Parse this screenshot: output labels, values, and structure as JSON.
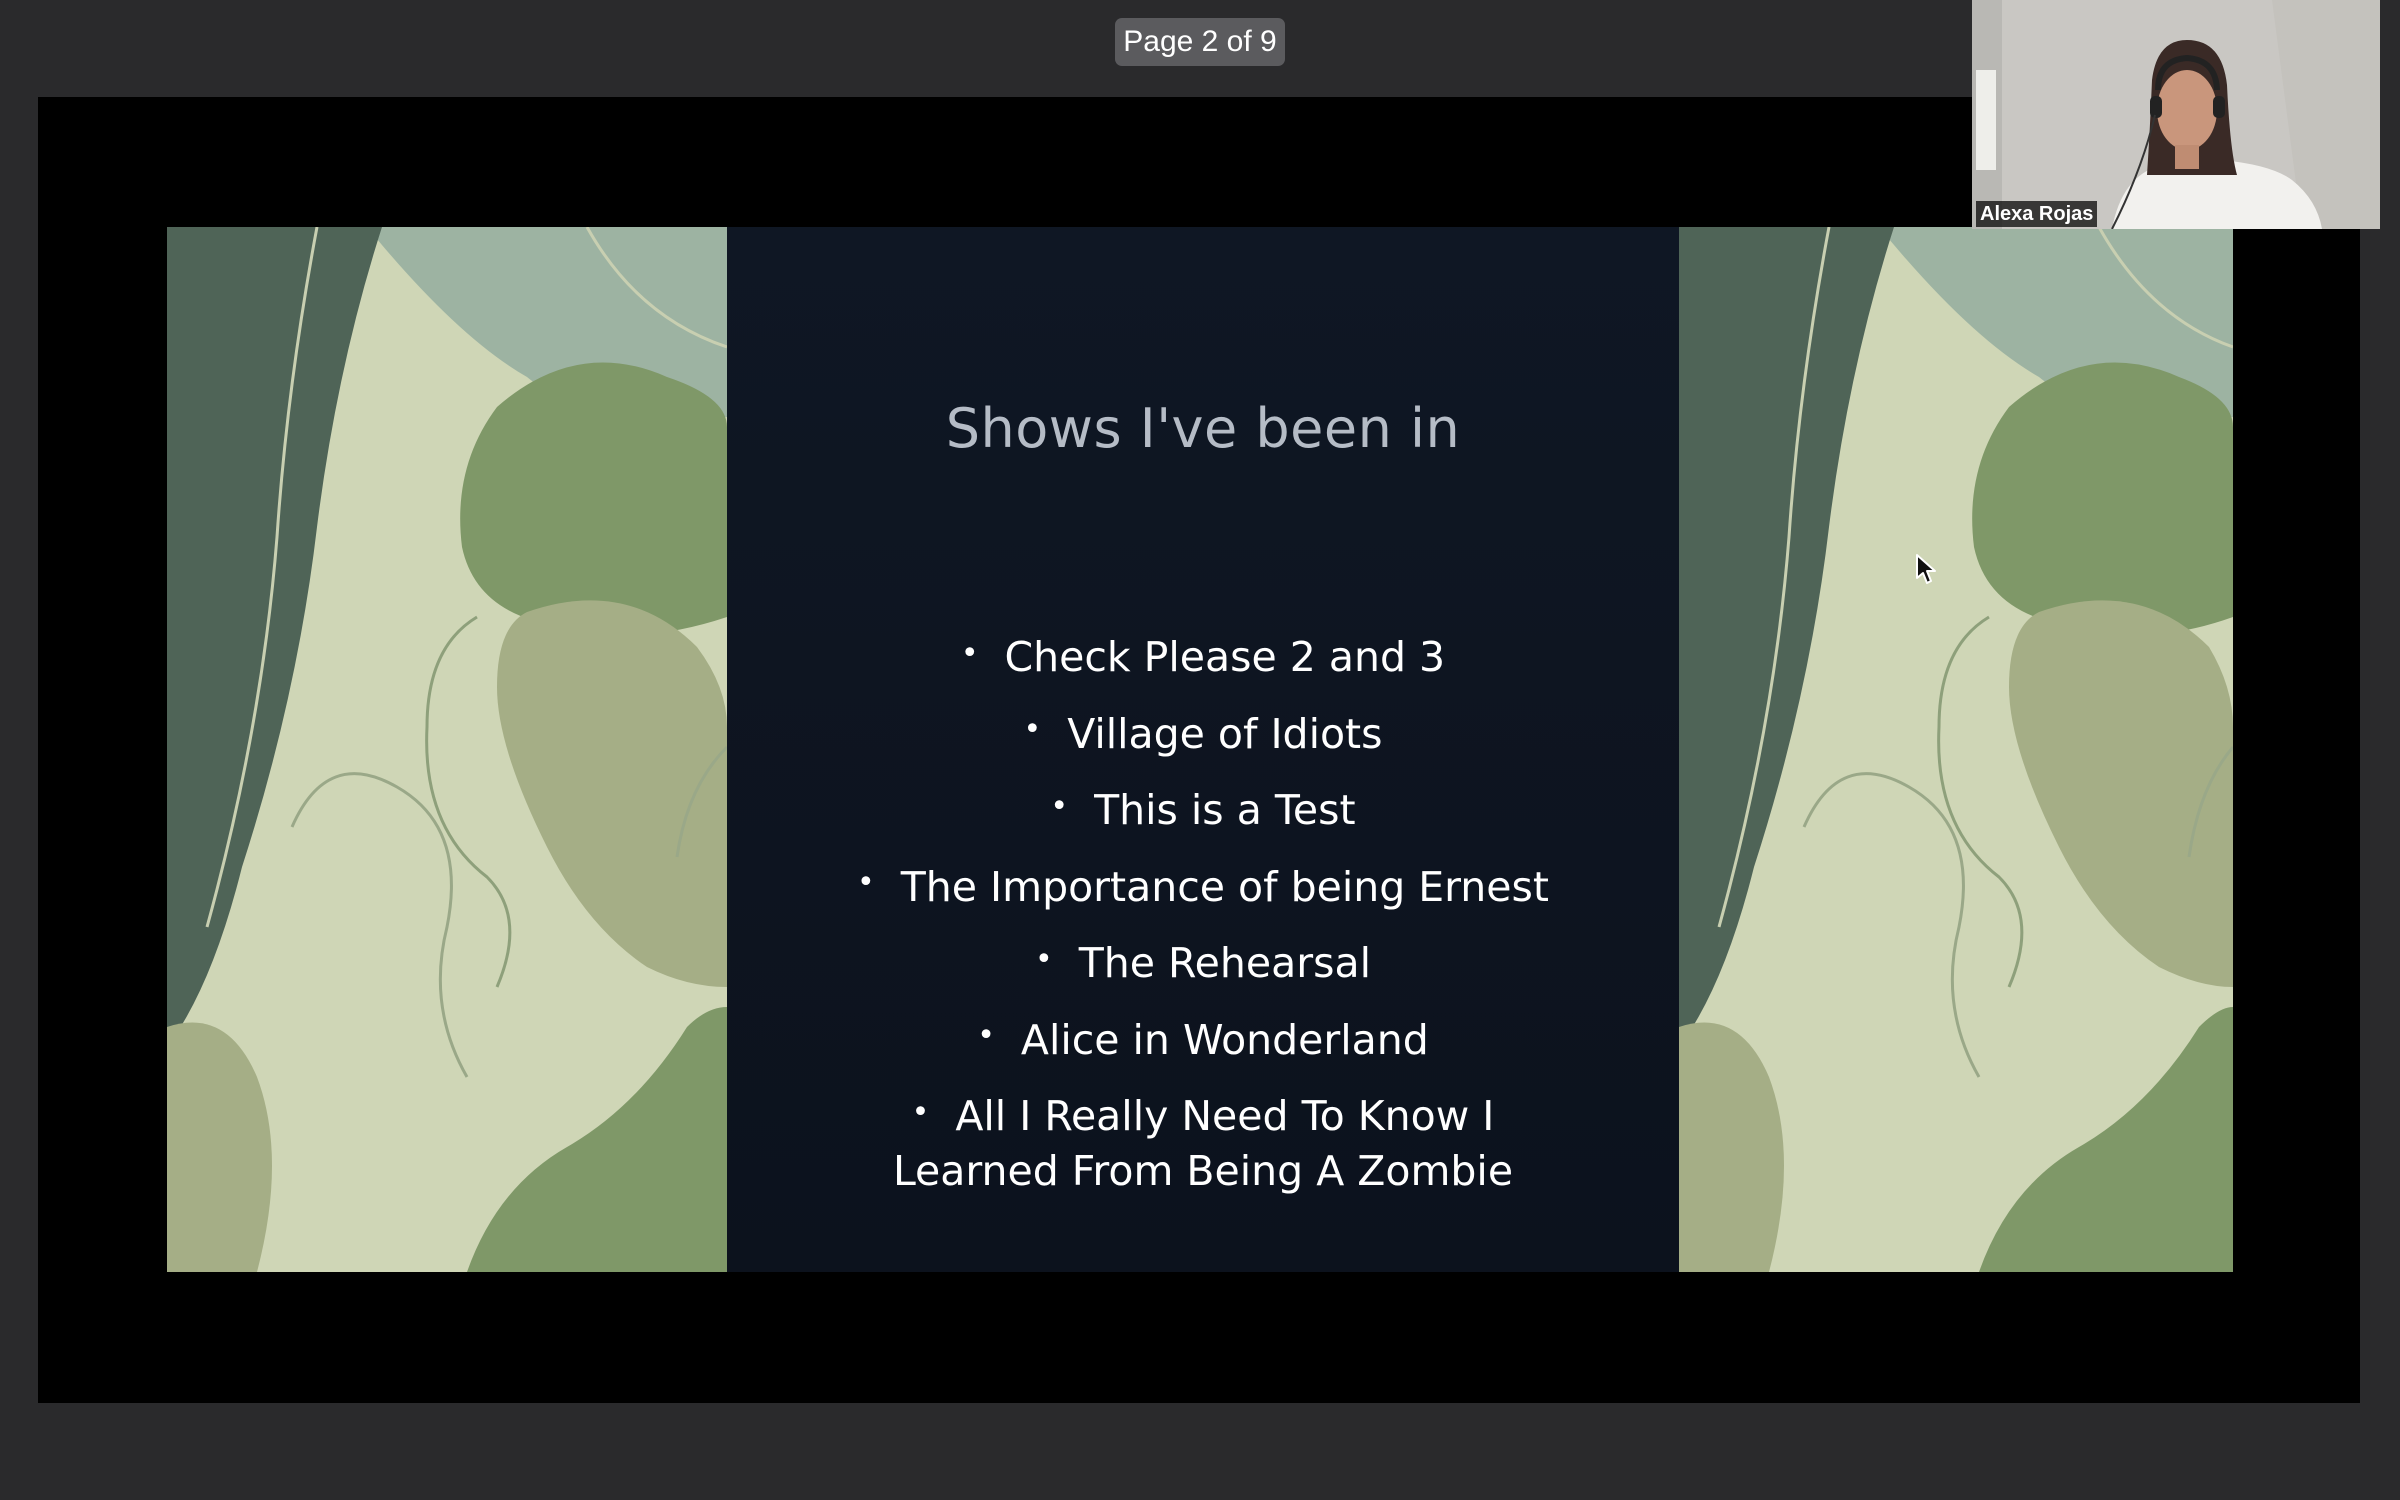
{
  "viewer": {
    "page_indicator": "Page 2 of 9"
  },
  "slide": {
    "title": "Shows I've been in",
    "bullet_symbol": "•",
    "items": [
      "Check Please 2 and 3",
      "Village of Idiots",
      "This is a Test",
      "The Importance of being Ernest",
      "The Rehearsal",
      "Alice in Wonderland",
      "All I Really Need To Know I Learned From Being A Zombie"
    ],
    "colors": {
      "background": "#0e1420",
      "title": "#b5bcc6",
      "text": "#ffffff",
      "pattern_light": "#cfd6b6",
      "pattern_mid": "#a5ae86",
      "pattern_green": "#7f9868",
      "pattern_dark": "#4f6457",
      "pattern_sky": "#9db3a2"
    }
  },
  "participant": {
    "name": "Alexa Rojas"
  },
  "icons": {
    "cursor": "mouse-pointer-icon"
  }
}
